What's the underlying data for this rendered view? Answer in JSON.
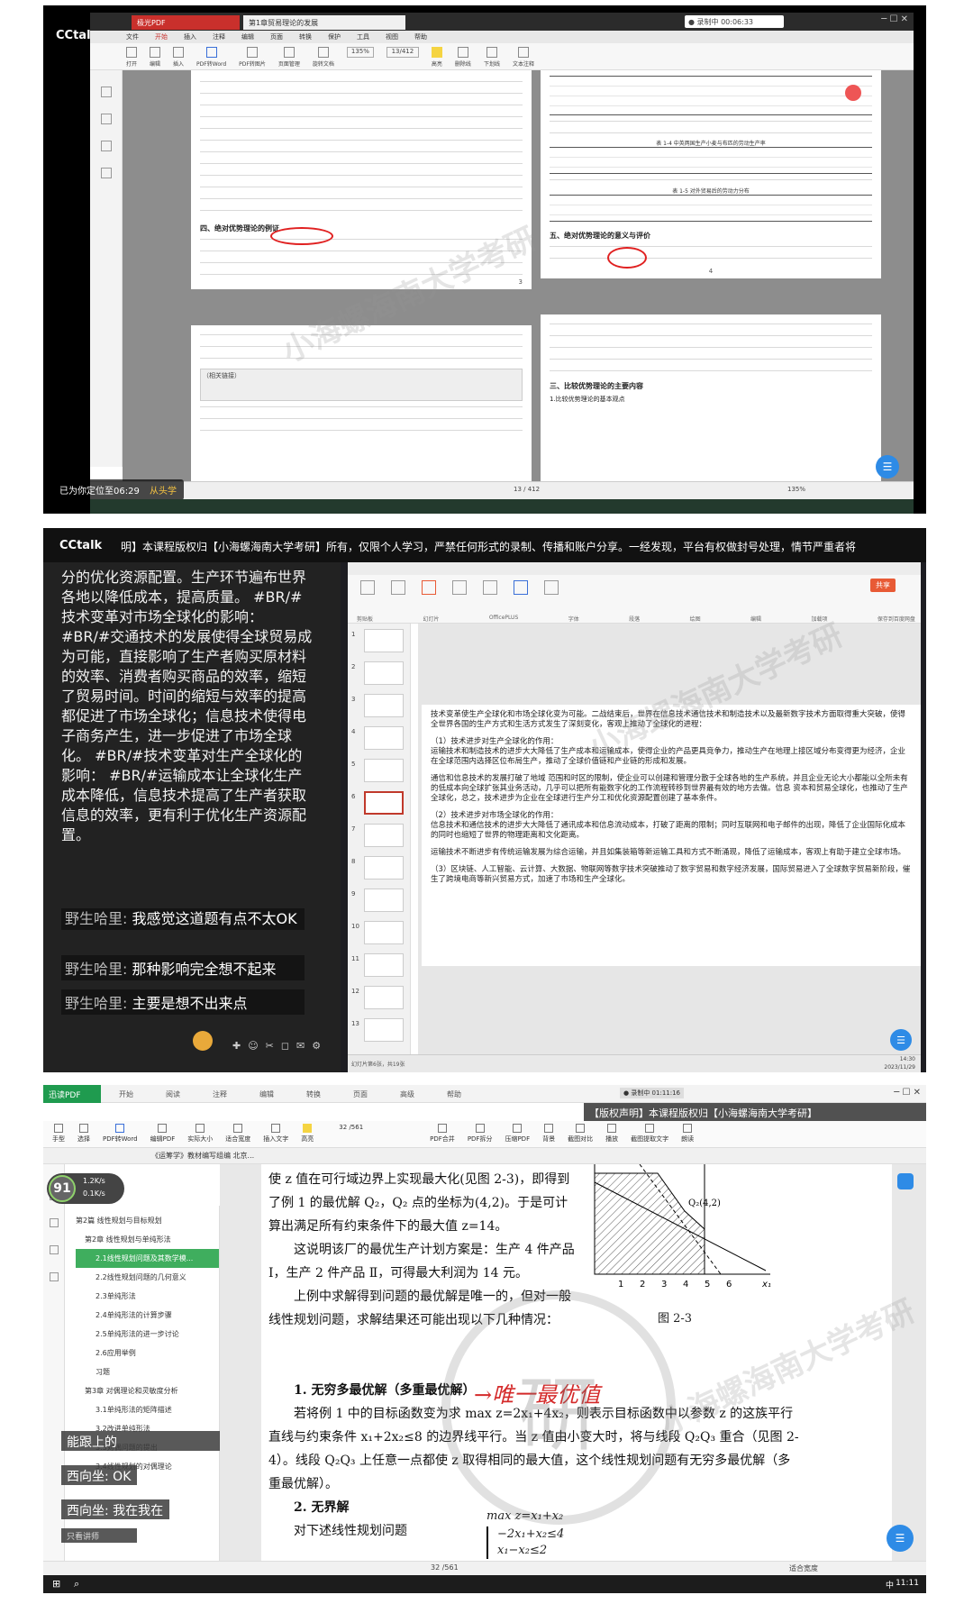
{
  "p1": {
    "brand": "CCtalk",
    "tab1": "极光PDF",
    "tab2": "第1章贸易理论的发展",
    "rec": "● 录制中 00:06:33",
    "menu": [
      "文件",
      "开始",
      "插入",
      "注释",
      "编辑",
      "页面",
      "转换",
      "保护",
      "工具",
      "视图",
      "帮助"
    ],
    "tools": [
      "打开",
      "编辑",
      "插入",
      "PDF转Word",
      "PDF转图片",
      "页面管理",
      "旋转文档",
      "高亮",
      "删除线",
      "下划线",
      "文本注释"
    ],
    "zoom": "135%",
    "page": "13/412",
    "toc": "四、绝对优势理论的例证",
    "toc2": "五、绝对优势理论的意义与评价",
    "table_title1": "表 1-4 中英两国生产小麦与布匹的劳动生产率",
    "table_title2": "表 1-5 对外贸易后的劳动力分布",
    "subheads": [
      "三、比较优势理论的主要内容",
      "1.比较优势理论的基本观点",
      "（相关链接）"
    ],
    "pagenums": [
      "3",
      "4"
    ],
    "pos": "已为你定位至06:29",
    "pos_btn": "从头学",
    "zoom2": "135%",
    "page2": "13 / 412"
  },
  "p2": {
    "brand": "CCtalk",
    "notice": "明】本课程版权归【小海螺海南大学考研】所有，仅限个人学习，严禁任何形式的录制、传播和账户分享。一经发现，平台有权做封号处理，情节严重者将",
    "chat_big": "分的优化资源配置。生产环节遍布世界各地以降低成本，提高质量。 #BR/#技术变革对市场全球化的影响： #BR/#交通技术的发展使得全球贸易成为可能，直接影响了生产者购买原材料的效率、消费者购买商品的效率，缩短了贸易时间。时间的缩短与效率的提高都促进了市场全球化；信息技术使得电子商务产生，进一步促进了市场全球化。 #BR/#技术变革对生产全球化的影响： #BR/#运输成本让全球化生产成本降低，信息技术提高了生产者获取信息的效率，更有利于优化生产资源配置。",
    "msgs": [
      {
        "user": "野生哈里:",
        "text": "我感觉这道题有点不太OK"
      },
      {
        "user": "野生哈里:",
        "text": "那种影响完全想不起来"
      },
      {
        "user": "野生哈里:",
        "text": "主要是想不出来点"
      }
    ],
    "slide_nums": [
      "1",
      "2",
      "3",
      "4",
      "5",
      "6",
      "7",
      "8",
      "9",
      "10",
      "11",
      "12",
      "13"
    ],
    "ribbon": [
      "剪贴板",
      "幻灯片",
      "OfficePLUS",
      "字体",
      "段落",
      "绘图",
      "编辑",
      "加载项",
      "保存到百度网盘"
    ],
    "doc_p1": "技术变革使生产全球化和市场全球化变为可能。二战结束后，世界在信息技术通信技术和制造技术以及最新数字技术方面取得重大突破，使得全世界各国的生产方式和生活方式发生了深刻变化，客观上推动了全球化的进程：",
    "doc_h1": "（1）技术进步对生产全球化的作用：",
    "doc_p2": "运输技术和制造技术的进步大大降低了生产成本和运输成本，使得企业的产品更具竞争力，推动生产在地理上接区域分布变得更为经济，企业在全球范围内选择区位布局生产，推动了全球价值链和产业链的形成和发展。",
    "doc_p3": "通信和信息技术的发展打破了地域 范围和时区的限制，使企业可以创建和管理分散于全球各地的生产系统，并且企业无论大小都能以全所未有的低成本向全球扩张其业务活动，几乎可以把所有能数字化的工作流程转移到世界最有效的地方去做。信息 资本和贸易全球化，也推动了生产全球化，总之，技术进步为企业在全球进行生产分工和优化资源配置创建了基本条件。",
    "doc_h2": "（2）技术进步对市场全球化的作用：",
    "doc_p4": "信息技术和通信技术的进步大大降低了通讯成本和信息流动成本，打破了距离的限制；同时互联网和电子邮件的出现，降低了企业国际化成本的同时也缩短了世界的物理距离和文化距离。",
    "doc_p5": "运输技术不断进步有传统运输发展为综合运输，并且如集装箱等新运输工具和方式不断涌现，降低了运输成本，客观上有助于建立全球市场。",
    "doc_p6": "（3）区块链、人工智能、云计算、大数据、物联网等数字技术突破推动了数字贸易和数字经济发展，国际贸易进入了全球数字贸易新阶段，催生了跨境电商等新兴贸易方式，加速了市场和生产全球化。",
    "status": "幻灯片第6张，共19张",
    "time": "14:30",
    "date": "2023/11/29",
    "share": "共享"
  },
  "p3": {
    "app": "迅读PDF",
    "notice": "【版权声明】本课程版权归【小海螺海南大学考研】",
    "rec": "● 录制中 01:11:16",
    "menu": [
      "开始",
      "阅读",
      "注释",
      "编辑",
      "转换",
      "页面",
      "高级",
      "帮助"
    ],
    "tools": [
      "手型",
      "选择",
      "PDF转Word",
      "编辑PDF",
      "实际大小",
      "适合宽度",
      "插入文字",
      "高亮",
      "PDF合并",
      "PDF拆分",
      "压缩PDF",
      "背景",
      "截图对比",
      "播放",
      "截图提取文字",
      "朗读"
    ],
    "doc_tab": "《运筹学》教材编写组编 北京...",
    "page": "32",
    "pages": "/561",
    "badge": "91",
    "speed1": "1.2K/s",
    "speed2": "0.1K/s",
    "toc": [
      "第2篇 线性规划与目标规划",
      "第2章 线性规划与单纯形法",
      "2.1线性规划问题及其数学模...",
      "2.2线性规划问题的几何意义",
      "2.3单纯形法",
      "2.4单纯形法的计算步骤",
      "2.5单纯形法的进一步讨论",
      "2.6应用举例",
      "习题",
      "第3章 对偶理论和灵敏度分析",
      "3.1单纯形法的矩阵描述",
      "3.2改进单纯形法",
      "3.3对偶问题的提出",
      "3.4线性规划的对偶理论"
    ],
    "chat": [
      {
        "user": "",
        "text": "能跟上的"
      },
      {
        "user": "西向坐:",
        "text": "OK"
      },
      {
        "user": "西向坐:",
        "text": "我在我在"
      }
    ],
    "teacher_only": "只看讲师",
    "book": [
      "使 z 值在可行域边界上实现最大化(见图 2-3)，即得到了例 1 的最优解 Q₂，Q₂ 点的坐标为(4,2)。于是可计算出满足所有约束条件下的最大值 z=14。",
      "这说明该厂的最优生产计划方案是：生产 4 件产品 Ⅰ，生产 2 件产品 Ⅱ，可得最大利润为 14 元。",
      "上例中求解得到问题的最优解是唯一的，但对一般线性规划问题，求解结果还可能出现以下几种情况：",
      "1. 无穷多最优解（多重最优解）",
      "若将例 1 中的目标函数变为求 max z=2x₁+4x₂，则表示目标函数中以参数 z 的这族平行直线与约束条件 x₁+2x₂≤8 的边界线平行。当 z 值由小变大时，将与线段 Q₂Q₃ 重合（见图 2-4）。线段 Q₂Q₃ 上任意一点都使 z 取得相同的最大值，这个线性规划问题有无穷多最优解（多重最优解）。",
      "2. 无界解",
      "对下述线性规划问题"
    ],
    "handwrite": "→唯一最优值",
    "fig_label": "Q₂(4,2)",
    "fig_caption": "图 2-3",
    "axis_ticks": [
      "1",
      "2",
      "3",
      "4",
      "5",
      "6"
    ],
    "axis_x": "x₁",
    "math": [
      "max z=x₁+x₂",
      "−2x₁+x₂≤4",
      "x₁−x₂≤2"
    ],
    "stamp": "研",
    "fit": "适合宽度",
    "time": "11:11",
    "zh": "中"
  },
  "watermark": "小海螺海南大学考研"
}
